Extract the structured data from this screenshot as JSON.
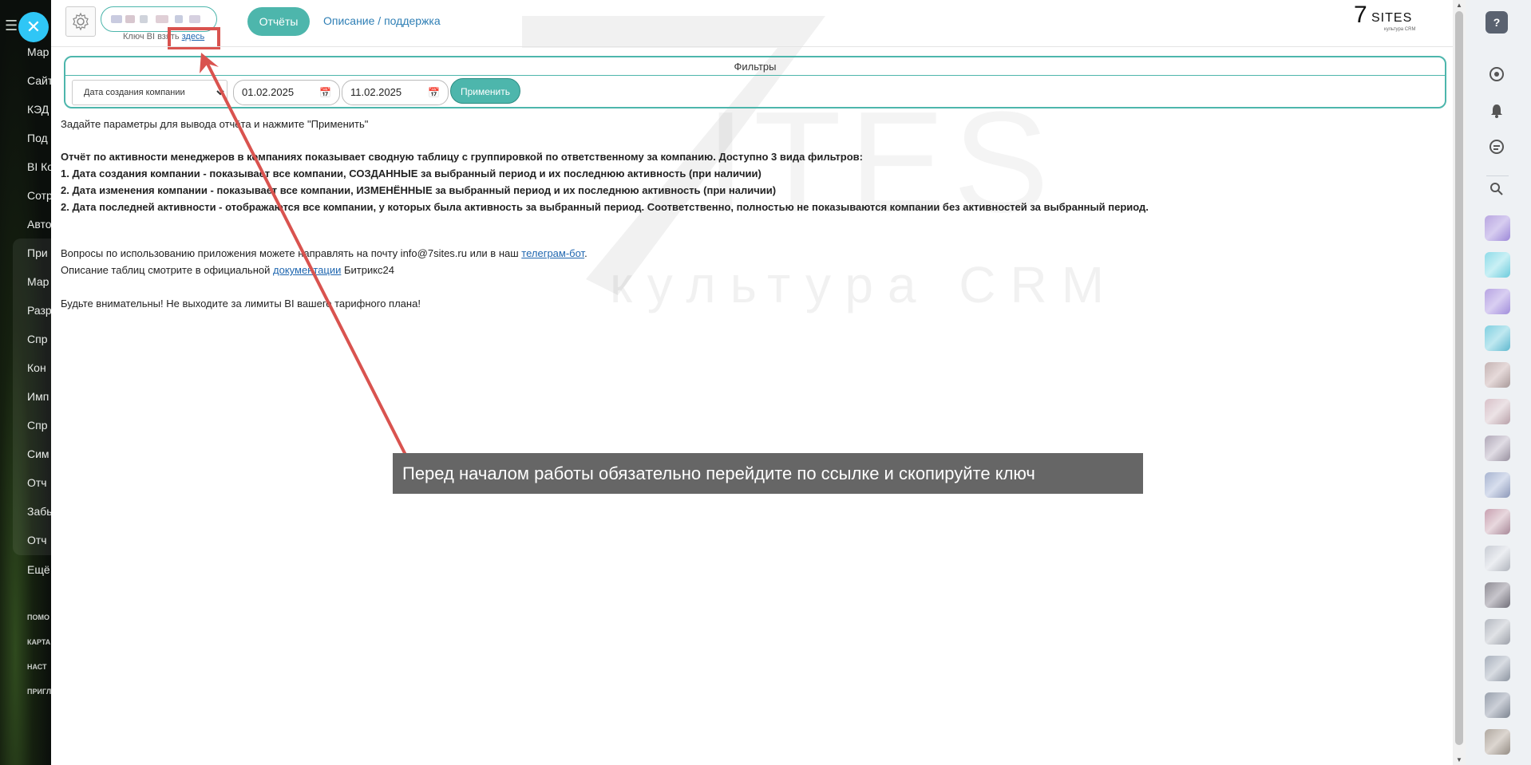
{
  "left_nav": {
    "items": [
      "Мар",
      "Сайт",
      "КЭД",
      "Под",
      "BI Ко",
      "Сотр",
      "Авто",
      "При",
      "Мар",
      "Разр",
      "Спр",
      "Кон",
      "Имп",
      "Спр",
      "Сим",
      "Отч",
      "Забь",
      "Отч",
      "Ещё"
    ],
    "small_items": [
      "ПОМО",
      "КАРТА",
      "НАСТ",
      "ПРИГЛ"
    ]
  },
  "header": {
    "reports_button": "Отчёты",
    "support_link": "Описание / поддержка",
    "key_hint_prefix": "Ключ BI взять ",
    "key_hint_link": "здесь",
    "brand_number": "7",
    "brand_name": "SITES",
    "brand_sub": "культура CRM"
  },
  "filters": {
    "title": "Фильтры",
    "type_selected": "Дата создания компании",
    "date_from": "01.02.2025",
    "date_to": "11.02.2025",
    "apply_button": "Применить"
  },
  "content": {
    "prompt": "Задайте параметры для вывода отчёта и нажмите \"Применить\"",
    "desc_intro": "Отчёт по активности менеджеров в компаниях показывает сводную таблицу с группировкой по ответственному за компанию. Доступно 3 вида фильтров:",
    "desc_1": "1. Дата создания компании - показывает все компании, СОЗДАННЫЕ за выбранный период и их последнюю активность (при наличии)",
    "desc_2": "2. Дата изменения компании - показывает все компании, ИЗМЕНЁННЫЕ за выбранный период и их последнюю активность (при наличии)",
    "desc_3": "2. Дата последней активности - отображаются все компании, у которых была активность за выбранный период. Соответственно, полностью не показываются компании без активностей за выбранный период.",
    "questions_prefix": "Вопросы по использованию приложения можете направлять на почту info@7sites.ru или в наш ",
    "questions_link": "телеграм-бот",
    "questions_suffix": ".",
    "tables_prefix": "Описание таблиц смотрите в официальной ",
    "tables_link": "документации",
    "tables_suffix": " Битрикс24",
    "warning": "Будьте внимательны! Не выходите за лимиты BI вашего тарифного плана!"
  },
  "watermark": {
    "tagline": "культура CRM"
  },
  "callout": {
    "text": "Перед началом работы обязательно перейдите по ссылке и скопируйте ключ"
  },
  "right_panel": {
    "help_label": "?"
  },
  "colors": {
    "accent": "#4db6ac",
    "link": "#2067b0",
    "highlight": "#d9534f",
    "callout_bg": "#666666",
    "close_button": "#2fc6f6"
  }
}
